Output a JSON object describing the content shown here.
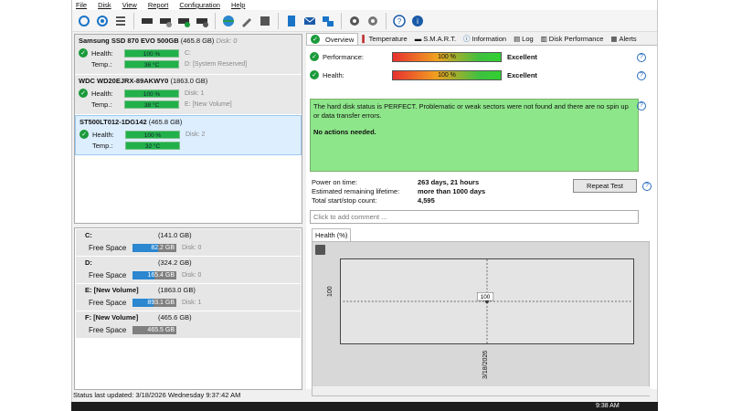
{
  "menu": [
    "File",
    "Disk",
    "View",
    "Report",
    "Configuration",
    "Help"
  ],
  "toolbar_icons": [
    "refresh-icon",
    "refresh-all-icon",
    "list-icon",
    "disk-icon",
    "disk-info-icon",
    "disk-check-icon",
    "disk-settings-icon",
    "globe-icon",
    "tools-icon",
    "save-icon",
    "report-icon",
    "mail-icon",
    "network-icon",
    "gear-icon",
    "gear-alt-icon",
    "help-icon",
    "about-icon"
  ],
  "disks": [
    {
      "name": "Samsung SSD 870 EVO 500GB",
      "size": "(465.8 GB)",
      "disk": "Disk: 0",
      "health_label": "Health:",
      "health": "100 %",
      "temp_label": "Temp.:",
      "temp": "36 °C",
      "vol1": "C:",
      "vol2": "D: [System Reserved]"
    },
    {
      "name": "WDC WD20EJRX-89AKWY0",
      "size": "(1863.0 GB)",
      "disk": "Disk: 1",
      "health_label": "Health:",
      "health": "100 %",
      "temp_label": "Temp.:",
      "temp": "38 °C",
      "vol1": "E: [New Volume]",
      "vol2": ""
    },
    {
      "name": "ST500LT012-1DG142",
      "size": "(465.8 GB)",
      "disk": "Disk: 2",
      "health_label": "Health:",
      "health": "100 %",
      "temp_label": "Temp.:",
      "temp": "32 °C",
      "vol1": "",
      "vol2": ""
    }
  ],
  "drives": [
    {
      "name": "C:",
      "size": "(141.0 GB)",
      "free_label": "Free Space",
      "free": "82.2 GB",
      "disk": "Disk: 0",
      "fill": 0.58
    },
    {
      "name": "D:",
      "size": "(324.2 GB)",
      "free_label": "Free Space",
      "free": "165.4 GB",
      "disk": "Disk: 0",
      "fill": 0.51
    },
    {
      "name": "E: [New Volume]",
      "size": "(1863.0 GB)",
      "free_label": "Free Space",
      "free": "893.1 GB",
      "disk": "Disk: 1",
      "fill": 0.48
    },
    {
      "name": "F: [New Volume]",
      "size": "(465.6 GB)",
      "free_label": "Free Space",
      "free": "465.5 GB",
      "disk": "",
      "fill": 0.0
    }
  ],
  "tabs": [
    "Overview",
    "Temperature",
    "S.M.A.R.T.",
    "Information",
    "Log",
    "Disk Performance",
    "Alerts"
  ],
  "overview": {
    "performance_label": "Performance:",
    "performance_value": "100 %",
    "performance_rating": "Excellent",
    "health_label": "Health:",
    "health_value": "100 %",
    "health_rating": "Excellent",
    "status_text": "The hard disk status is PERFECT. Problematic or weak sectors were not found and there are no spin up or data transfer errors.",
    "status_action": "No actions needed.",
    "power_on_label": "Power on time:",
    "power_on": "263 days, 21 hours",
    "remaining_label": "Estimated remaining lifetime:",
    "remaining": "more than 1000 days",
    "startstop_label": "Total start/stop count:",
    "startstop": "4,595",
    "repeat_label": "Repeat Test",
    "comment_placeholder": "Click to add comment ..."
  },
  "graph": {
    "tab_label": "Health (%)",
    "point_value": "100",
    "y_tick": "100",
    "x_tick": "3/18/2026"
  },
  "chart_data": {
    "type": "scatter",
    "x": [
      "3/18/2026"
    ],
    "values": [
      100
    ],
    "title": "",
    "xlabel": "",
    "ylabel": ""
  },
  "status_bar": "Status last updated: 3/18/2026 Wednesday 9:37:42 AM",
  "taskbar": {
    "time": "9:38 AM"
  }
}
